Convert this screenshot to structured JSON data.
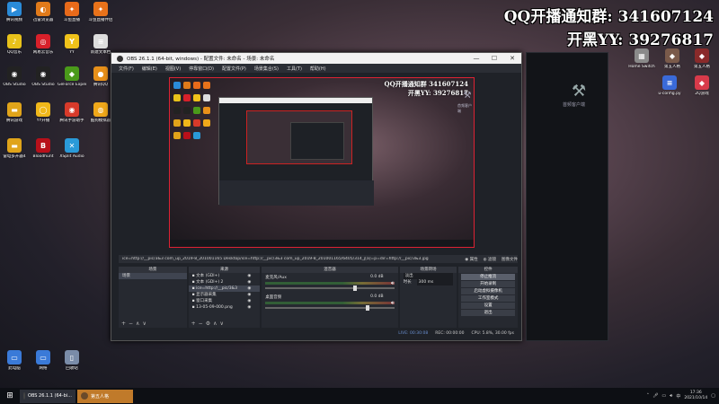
{
  "desktop": {
    "icons_left": [
      {
        "label": "腾讯视频",
        "icon": "play-icon",
        "color": "#2a8bd8",
        "glyph": "▶"
      },
      {
        "label": "迅雷浏览器",
        "icon": "browser-icon",
        "color": "#e07a1a",
        "glyph": "◐"
      },
      {
        "label": "斗鱼直播",
        "icon": "fish-icon",
        "color": "#e86a1a",
        "glyph": "✦"
      },
      {
        "label": "斗鱼直播伴侣",
        "icon": "fish-icon",
        "color": "#e8721a",
        "glyph": "✦"
      },
      {
        "label": "QQ音乐",
        "icon": "music-icon",
        "color": "#e8c21a",
        "glyph": "♪"
      },
      {
        "label": "网易云音乐",
        "icon": "netease-music-icon",
        "color": "#d8202a",
        "glyph": "◎"
      },
      {
        "label": "YY",
        "icon": "yy-icon",
        "color": "#f0c21a",
        "glyph": "Y"
      },
      {
        "label": "新建文本档",
        "icon": "text-file-icon",
        "color": "#dddddd",
        "glyph": "≡"
      },
      {
        "label": "OBS Studio",
        "icon": "obs-icon",
        "color": "#222222",
        "glyph": "◉"
      },
      {
        "label": "OBS Studio",
        "icon": "obs-icon",
        "color": "#222222",
        "glyph": "◉"
      },
      {
        "label": "GeForce Experience",
        "icon": "nvidia-icon",
        "color": "#4a9a1a",
        "glyph": "◆"
      },
      {
        "label": "腾讯QQ",
        "icon": "qq-icon",
        "color": "#e8901a",
        "glyph": "●"
      },
      {
        "label": "腾讯游戏",
        "icon": "folder-icon",
        "color": "#e0a41a",
        "glyph": "▬"
      },
      {
        "label": "YY开播",
        "icon": "yy-live-icon",
        "color": "#f0b81a",
        "glyph": "◯"
      },
      {
        "label": "腾讯手游助手",
        "icon": "game-assistant-icon",
        "color": "#d83a2a",
        "glyph": "◉"
      },
      {
        "label": "酷狗模拟器",
        "icon": "emulator-icon",
        "color": "#f0a81a",
        "glyph": "◍"
      },
      {
        "label": "雷电多开器4",
        "icon": "folder-icon",
        "color": "#e0a41a",
        "glyph": "▬"
      },
      {
        "label": "Bloodhunt",
        "icon": "bloodhunt-icon",
        "color": "#b8101a",
        "glyph": "B"
      },
      {
        "label": "XSplit Audio",
        "icon": "xsplit-icon",
        "color": "#2a9ad8",
        "glyph": "✕"
      },
      {
        "label": "此电脑",
        "icon": "computer-icon",
        "color": "#3a7ad8",
        "glyph": "▭"
      },
      {
        "label": "网络",
        "icon": "network-icon",
        "color": "#3a7ad8",
        "glyph": "▭"
      },
      {
        "label": "回收站",
        "icon": "recycle-bin-icon",
        "color": "#7a8ca8",
        "glyph": "▯"
      }
    ],
    "icons_right": [
      {
        "label": "Home Switch",
        "icon": "app-icon",
        "color": "#8a8a8a",
        "glyph": "▦"
      },
      {
        "label": "第五人格",
        "icon": "game-icon",
        "color": "#7a5a4a",
        "glyph": "◆"
      },
      {
        "label": "第五人格",
        "icon": "game-icon",
        "color": "#8a2a2a",
        "glyph": "◆"
      },
      {
        "label": "u-config.py",
        "icon": "python-file-icon",
        "color": "#3a6ad8",
        "glyph": "≡"
      },
      {
        "label": "2Q游戏",
        "icon": "game-icon",
        "color": "#d83a4a",
        "glyph": "◆"
      }
    ],
    "watermark_line1": "QQ开播通知群: 341607124",
    "watermark_line2": "开黑YY: 39276817",
    "right_window_label": "首频客户端"
  },
  "obs": {
    "title": "OBS 26.1.1 (64-bit, windows) - 配置文件: 未命名 - 场景: 未命名",
    "menu": [
      "文件(F)",
      "编辑(E)",
      "视图(V)",
      "停靠窗口(D)",
      "配置文件(P)",
      "场景集合(S)",
      "工具(T)",
      "帮助(H)"
    ],
    "preview_overlay1": "QQ开播通知群 341607124",
    "preview_overlay2": "开黑YY: 39276817",
    "preview_hammer_label": "首频客户端",
    "source_bar": {
      "url": "ice=http://__pic/3&3 com_up_2019-8_201001165 Desktop/ice=http://__pic/3&3 com_up_2019-8_201001165/6405/314_j[a]=p=dir=http://__pic/3&3.jpg",
      "properties": "◉ 属性",
      "filters": "◍ 滤镜",
      "image_file": "图像文件"
    },
    "panels": {
      "scenes_title": "场景",
      "scenes": [
        "场景"
      ],
      "sources_title": "来源",
      "sources": [
        "文本 (GDI+)",
        "文本 (GDI+) 2",
        "ice=http://__pic/3&3",
        "显示器采集",
        "窗口采集",
        "13-05-09-000.png"
      ],
      "mixer_title": "混音器",
      "mixer": [
        {
          "name": "麦克风/Aux",
          "db": "0.0 dB",
          "knob": 0.68
        },
        {
          "name": "桌面音频",
          "db": "0.0 dB",
          "knob": 0.78
        }
      ],
      "transitions_title": "场景转场",
      "transition_value": "淡出",
      "duration_label": "时长",
      "duration_value": "300 ms",
      "controls_title": "控件",
      "controls": [
        "停止推流",
        "开始录制",
        "启动虚拟摄像机",
        "工作室模式",
        "设置",
        "退出"
      ]
    },
    "status": {
      "live": "LIVE: 00:30:08",
      "rec": "REC: 00:00:00",
      "cpu": "CPU: 5.8%, 30.00 fps"
    }
  },
  "taskbar": {
    "obs_task": "OBS 26.1.1 (64-bi...",
    "sec_task": "第五人格",
    "time": "17:36",
    "date": "2021/10/14"
  }
}
